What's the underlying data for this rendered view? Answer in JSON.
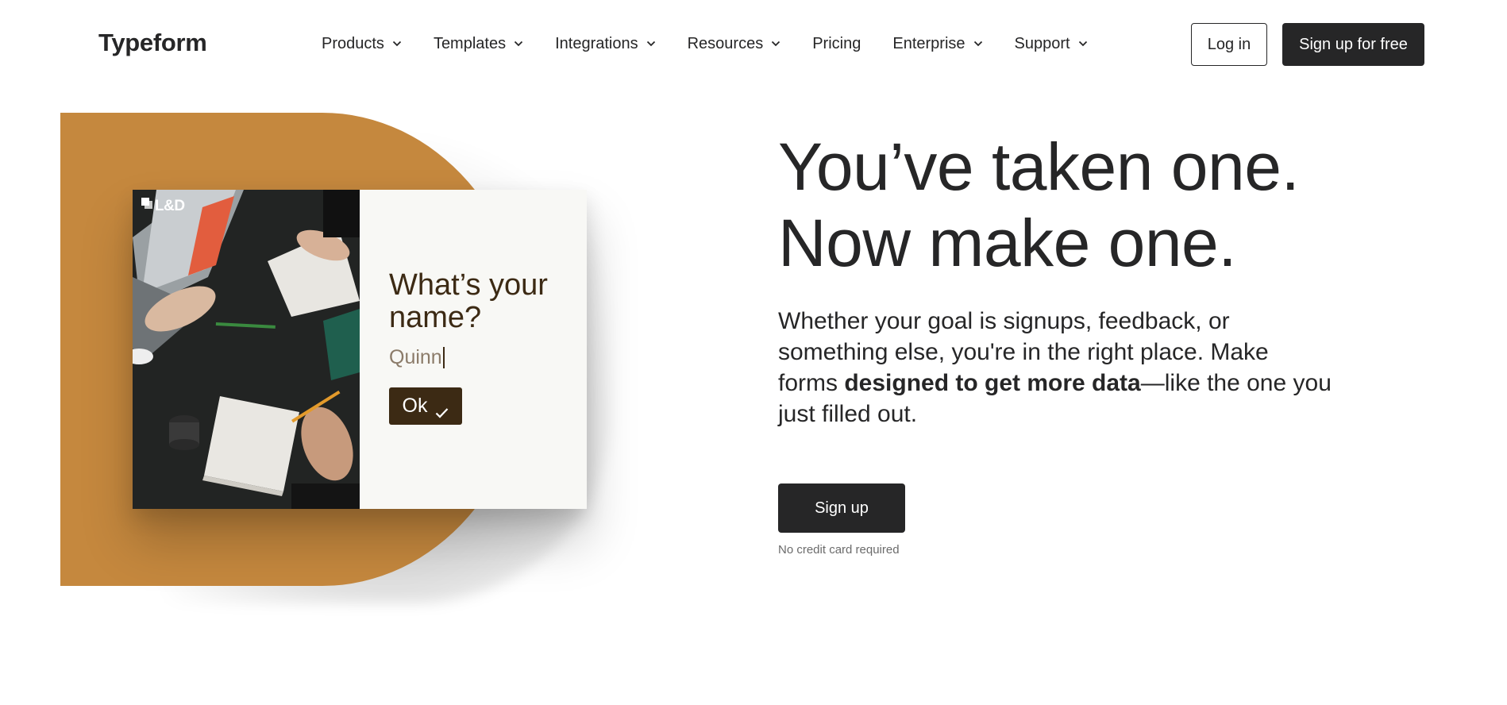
{
  "header": {
    "logo": "Typeform",
    "nav": [
      {
        "label": "Products",
        "has_dropdown": true
      },
      {
        "label": "Templates",
        "has_dropdown": true
      },
      {
        "label": "Integrations",
        "has_dropdown": true
      },
      {
        "label": "Resources",
        "has_dropdown": true
      },
      {
        "label": "Pricing",
        "has_dropdown": false
      },
      {
        "label": "Enterprise",
        "has_dropdown": true
      },
      {
        "label": "Support",
        "has_dropdown": true
      }
    ],
    "login_label": "Log in",
    "signup_free_label": "Sign up for free"
  },
  "hero_card": {
    "badge": "L&D",
    "question": "What’s your name?",
    "answer_value": "Quinn",
    "ok_label": "Ok"
  },
  "hero": {
    "headline_line1": "You’ve taken one.",
    "headline_line2": "Now make one.",
    "subtext_before": "Whether your goal is signups, feedback, or something else, you're in the right place. Make forms ",
    "subtext_bold": "designed to get more data",
    "subtext_after": "—like the one you just filled out.",
    "signup_label": "Sign up",
    "note": "No credit card required"
  },
  "colors": {
    "ink": "#262627",
    "blob": "#c5883e",
    "card_bg": "#f8f8f5",
    "form_accent": "#3c2a14"
  }
}
